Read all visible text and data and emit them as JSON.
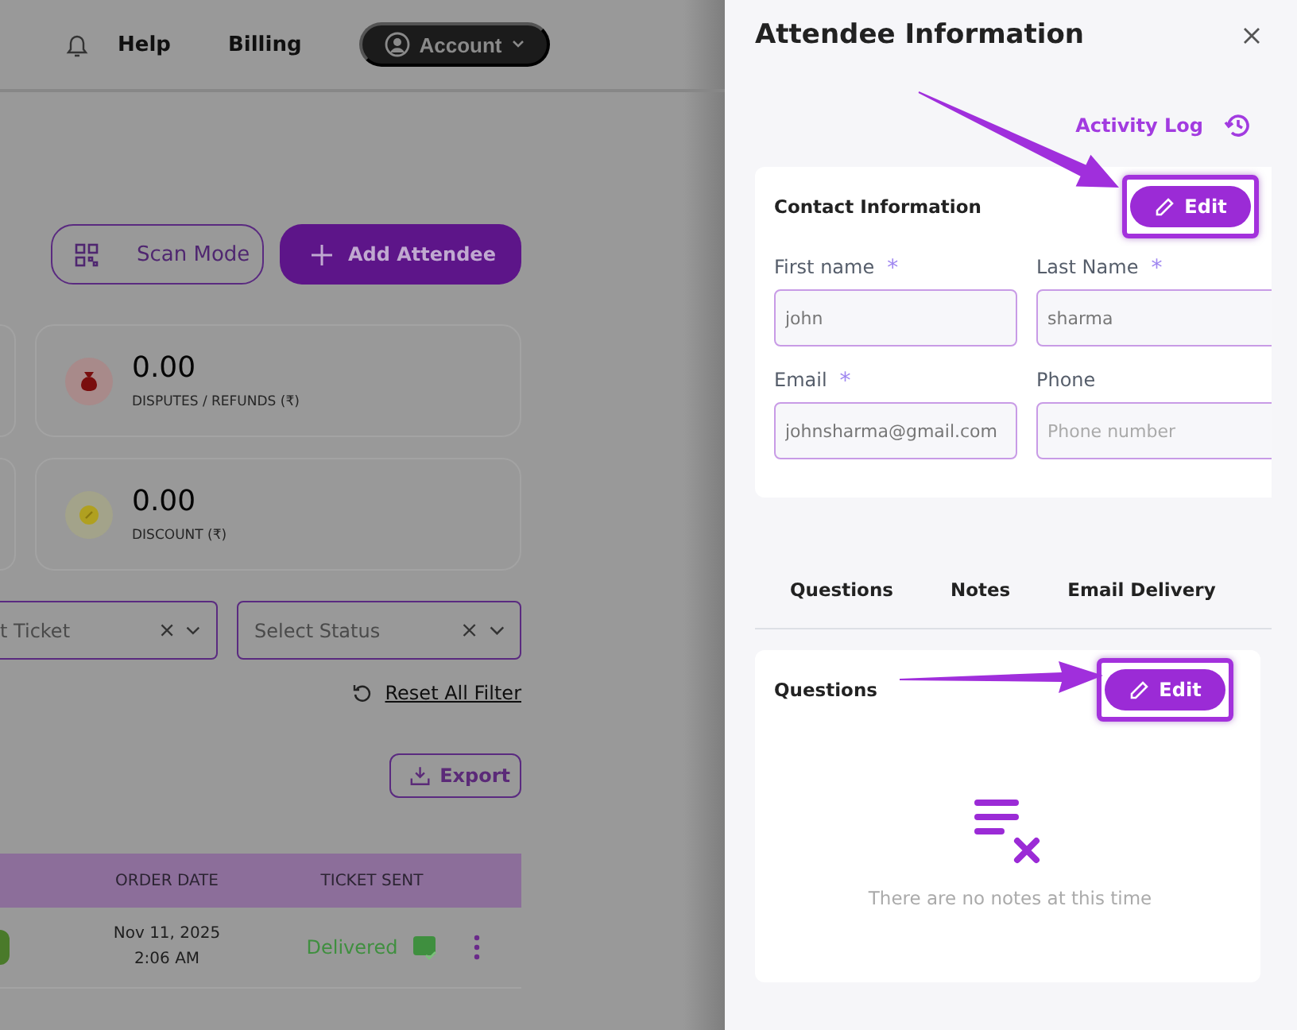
{
  "header": {
    "links": [
      "Help",
      "Billing"
    ],
    "account": "Account"
  },
  "actions": {
    "scan_mode": "Scan Mode",
    "add_attendee": "Add Attendee"
  },
  "stats": [
    {
      "kind": "refunds",
      "value": "0.00",
      "label": "DISPUTES / REFUNDS (₹)"
    },
    {
      "kind": "discount",
      "value": "0.00",
      "label": "DISCOUNT (₹)"
    }
  ],
  "filters": [
    {
      "placeholder": "t Ticket"
    },
    {
      "placeholder": "Select Status"
    }
  ],
  "reset_filter": "Reset All Filter",
  "export": "Export",
  "table": {
    "columns": [
      "ORDER DATE",
      "TICKET SENT"
    ],
    "rows": [
      {
        "order_date": "Nov 11, 2025",
        "order_time": "2:06 AM",
        "ticket_sent": "Delivered"
      }
    ]
  },
  "drawer": {
    "title": "Attendee Information",
    "activity_log": "Activity Log",
    "contact": {
      "title": "Contact Information",
      "edit": {
        "label": "Edit",
        "highlighted": true
      },
      "fields": [
        {
          "label": "First name",
          "required_mark": "*",
          "value": "john"
        },
        {
          "label": "Last Name",
          "required_mark": "*",
          "value": "sharma"
        },
        {
          "label": "Email",
          "required_mark": "*",
          "value": "johnsharma@gmail.com"
        },
        {
          "label": "Phone",
          "placeholder": "Phone number"
        }
      ]
    },
    "tabs": [
      {
        "label": "Questions"
      },
      {
        "label": "Notes"
      },
      {
        "label": "Email Delivery"
      }
    ],
    "questions": {
      "title": "Questions",
      "edit": {
        "label": "Edit",
        "highlighted": true
      },
      "empty_text": "There are no notes at this time"
    }
  }
}
